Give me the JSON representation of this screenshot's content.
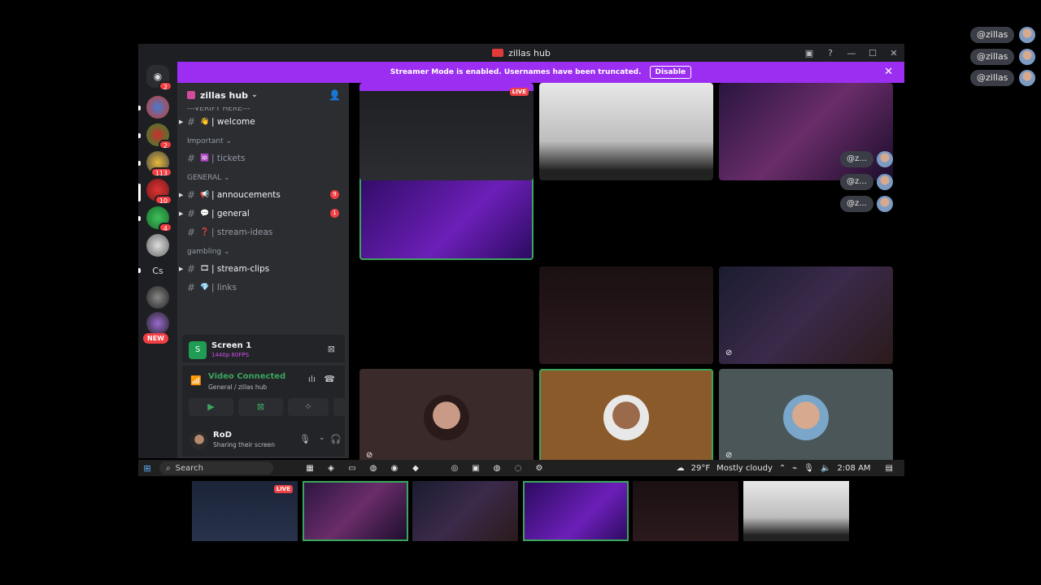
{
  "window": {
    "title": "zillas hub"
  },
  "banner": {
    "text": "Streamer Mode is enabled. Usernames have been truncated.",
    "action": "Disable"
  },
  "overlay_users": [
    "@zillas",
    "@zillas",
    "@zillas"
  ],
  "rail": {
    "badges": [
      "2",
      "2",
      "113",
      "10",
      "4"
    ],
    "extra_label": "Cs",
    "new_label": "NEW"
  },
  "sidebar": {
    "server_name": "zillas hub",
    "partial_category": "---VERIFY HERE---",
    "categories": [
      {
        "name": "Important",
        "channels": [
          {
            "emoji": "🆔",
            "name": "| tickets",
            "unread": false
          }
        ]
      },
      {
        "name": "GENERAL",
        "channels": [
          {
            "emoji": "📢",
            "name": "| annoucements",
            "unread": true,
            "badge": "9"
          },
          {
            "emoji": "💬",
            "name": "| general",
            "unread": true,
            "badge": "1"
          },
          {
            "emoji": "❓",
            "name": "| stream-ideas",
            "unread": false
          }
        ]
      },
      {
        "name": "gambling",
        "channels": [
          {
            "emoji": "🎞",
            "name": "| stream-clips",
            "unread": true
          },
          {
            "emoji": "💎",
            "name": "| links",
            "unread": false
          }
        ]
      }
    ],
    "welcome_channel": {
      "emoji": "👋",
      "name": "| welcome"
    }
  },
  "stream_card": {
    "name": "Screen 1",
    "quality": "1440p 60FPS"
  },
  "voice": {
    "status": "Video Connected",
    "location": "General / zillas hub"
  },
  "user": {
    "name": "RoD",
    "status": "Sharing their screen"
  },
  "grid_overlay_users": [
    "@z...",
    "@z...",
    "@z..."
  ],
  "tiles_live_label": "LIVE",
  "taskbar": {
    "search_placeholder": "Search",
    "weather": "29°F",
    "weather_desc": "Mostly cloudy",
    "time": "2:08 AM"
  },
  "colors": {
    "accent_purple": "#9b2ef0",
    "speaking_green": "#3ba55c",
    "badge_red": "#f23f43"
  }
}
